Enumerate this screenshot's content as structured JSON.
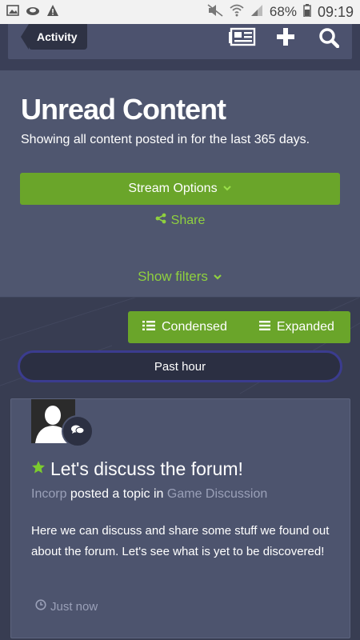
{
  "status_bar": {
    "battery": "68%",
    "time": "09:19"
  },
  "nav": {
    "activity_label": "Activity"
  },
  "header": {
    "title": "Unread Content",
    "subtitle": "Showing all content posted in for the last 365 days.",
    "stream_options_label": "Stream Options",
    "share_label": "Share",
    "show_filters_label": "Show filters"
  },
  "view_toggle": {
    "condensed_label": "Condensed",
    "expanded_label": "Expanded"
  },
  "time_filter": {
    "label": "Past hour"
  },
  "post": {
    "title": "Let's discuss the forum!",
    "author": "Incorp",
    "action": "posted a topic in",
    "forum": "Game Discussion",
    "body": "Here we can discuss and share some stuff we found out about the forum. Let's see what is yet to be discovered!",
    "time": "Just now"
  },
  "colors": {
    "accent_green": "#6aa52a",
    "link_green": "#8fd03f",
    "background": "#3b4158"
  }
}
